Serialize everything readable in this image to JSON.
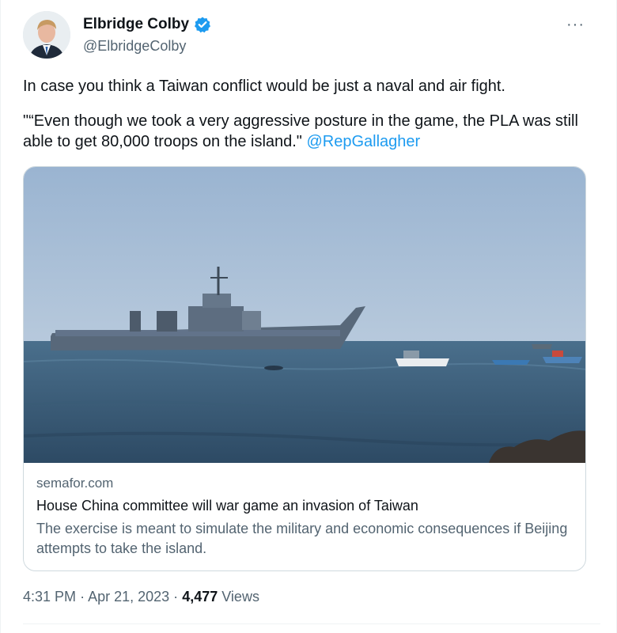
{
  "author": {
    "display_name": "Elbridge Colby",
    "handle": "@ElbridgeColby",
    "verified_color": "#1d9bf0"
  },
  "more_icon": "···",
  "tweet": {
    "line1": "In case you think a Taiwan conflict would be just a naval and air fight.",
    "line2": "\"“Even though we took a very aggressive posture in the game, the PLA was still able to get 80,000 troops on the island.\"",
    "mention": "@RepGallagher"
  },
  "card": {
    "domain": "semafor.com",
    "title": "House China committee will war game an invasion of Taiwan",
    "description": "The exercise is meant to simulate the military and economic consequences if Beijing attempts to take the island."
  },
  "footer": {
    "time": "4:31 PM",
    "date": "Apr 21, 2023",
    "views_count": "4,477",
    "views_label": "Views",
    "separator": "·"
  },
  "colors": {
    "accent": "#1d9bf0",
    "text_primary": "#0f1419",
    "text_secondary": "#536471"
  }
}
